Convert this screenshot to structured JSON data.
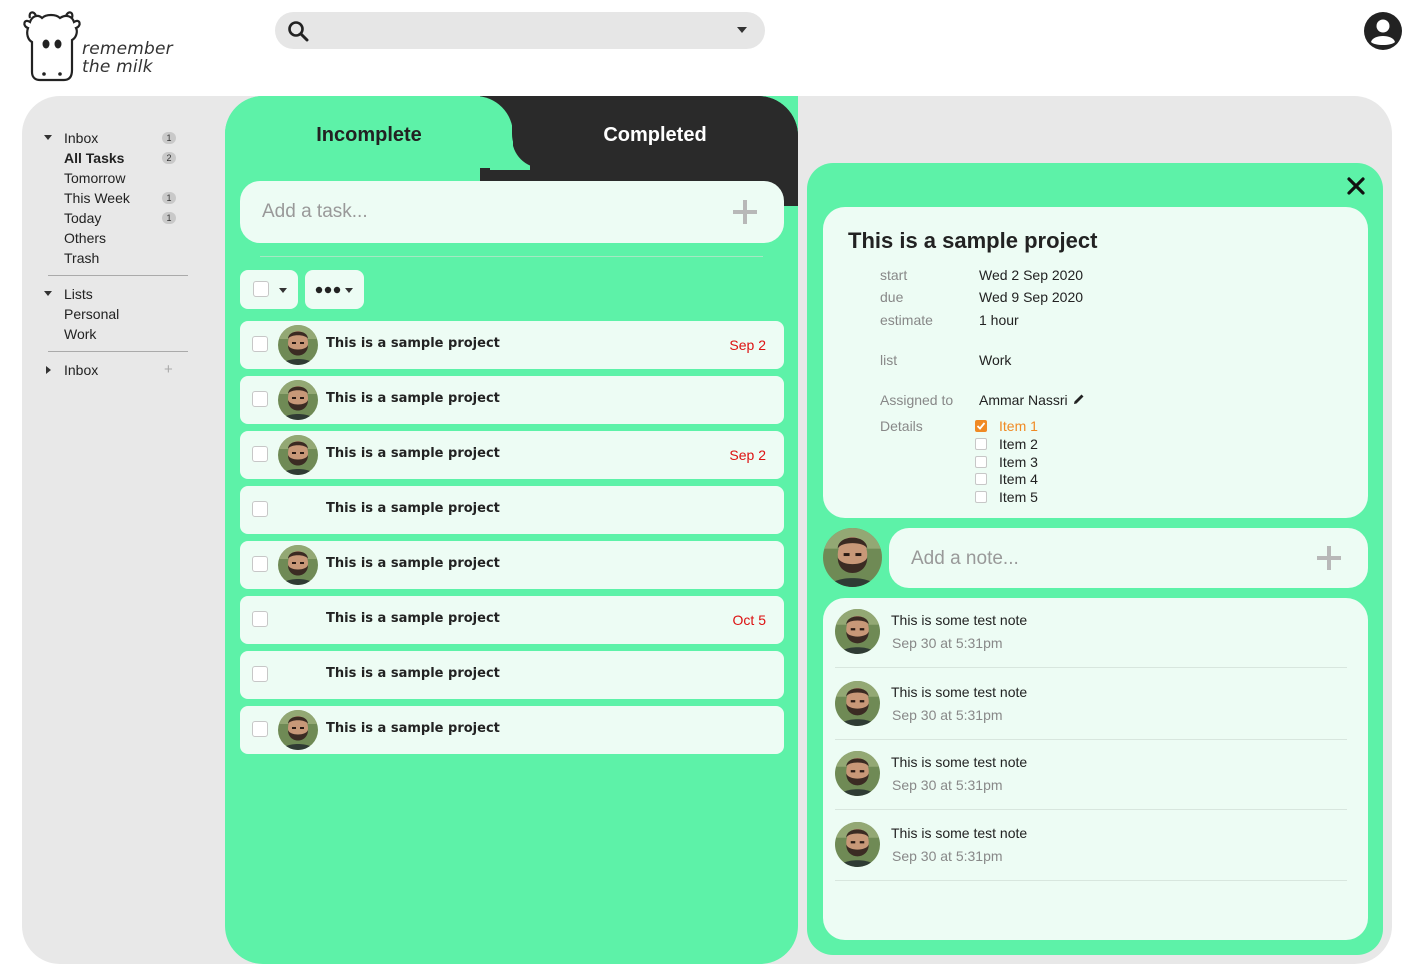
{
  "app": {
    "logo_line1": "remember",
    "logo_line2": "the milk"
  },
  "search": {
    "placeholder": "",
    "value": ""
  },
  "sidebar": {
    "inbox_section": {
      "label": "Inbox",
      "count": "1",
      "items": [
        {
          "label": "All Tasks",
          "count": "2",
          "bold": true
        },
        {
          "label": "Tomorrow",
          "count": ""
        },
        {
          "label": "This Week",
          "count": "1"
        },
        {
          "label": "Today",
          "count": "1"
        },
        {
          "label": "Others",
          "count": ""
        },
        {
          "label": "Trash",
          "count": ""
        }
      ]
    },
    "lists_section": {
      "label": "Lists",
      "items": [
        {
          "label": "Personal"
        },
        {
          "label": "Work"
        }
      ]
    },
    "collapsed_section": {
      "label": "Inbox",
      "add_icon": "+"
    }
  },
  "tabs": {
    "incomplete": "Incomplete",
    "completed": "Completed"
  },
  "add_task": {
    "placeholder": "Add a task..."
  },
  "tasks": [
    {
      "title": "This is a sample project",
      "date": "Sep 2",
      "avatar": true
    },
    {
      "title": "This is a sample project",
      "date": "",
      "avatar": true
    },
    {
      "title": "This is a sample project",
      "date": "Sep 2",
      "avatar": true
    },
    {
      "title": "This is a sample project",
      "date": "",
      "avatar": false
    },
    {
      "title": "This is a sample project",
      "date": "",
      "avatar": true
    },
    {
      "title": "This is a sample project",
      "date": "Oct 5",
      "avatar": false
    },
    {
      "title": "This is a sample project",
      "date": "",
      "avatar": false
    },
    {
      "title": "This is a sample project",
      "date": "",
      "avatar": true
    }
  ],
  "detail": {
    "title": "This is a sample project",
    "fields": {
      "start_label": "start",
      "start_value": "Wed 2 Sep 2020",
      "due_label": "due",
      "due_value": "Wed 9 Sep 2020",
      "estimate_label": "estimate",
      "estimate_value": "1 hour",
      "list_label": "list",
      "list_value": "Work",
      "assigned_label": "Assigned to",
      "assigned_value": "Ammar Nassri",
      "details_label": "Details"
    },
    "checklist": [
      {
        "label": "Item 1",
        "checked": true
      },
      {
        "label": "Item 2",
        "checked": false
      },
      {
        "label": "Item 3",
        "checked": false
      },
      {
        "label": "Item 4",
        "checked": false
      },
      {
        "label": "Item 5",
        "checked": false
      }
    ]
  },
  "add_note": {
    "placeholder": "Add a note..."
  },
  "notes": [
    {
      "text": "This is some test note",
      "time": "Sep 30 at 5:31pm"
    },
    {
      "text": "This is some test note",
      "time": "Sep 30 at 5:31pm"
    },
    {
      "text": "This is some test note",
      "time": "Sep 30 at 5:31pm"
    },
    {
      "text": "This is some test note",
      "time": "Sep 30 at 5:31pm"
    }
  ],
  "colors": {
    "accent_green": "#5df2a8",
    "card_bg": "#edfcf4",
    "dark_tab": "#2a2a2a",
    "due_red": "#dd1111",
    "checked_orange": "#f08a24"
  },
  "icons": {
    "search": "search-icon",
    "dropdown": "chevron-down-icon",
    "account": "user-account-icon",
    "add": "plus-icon",
    "close": "close-icon",
    "edit": "pencil-icon"
  }
}
